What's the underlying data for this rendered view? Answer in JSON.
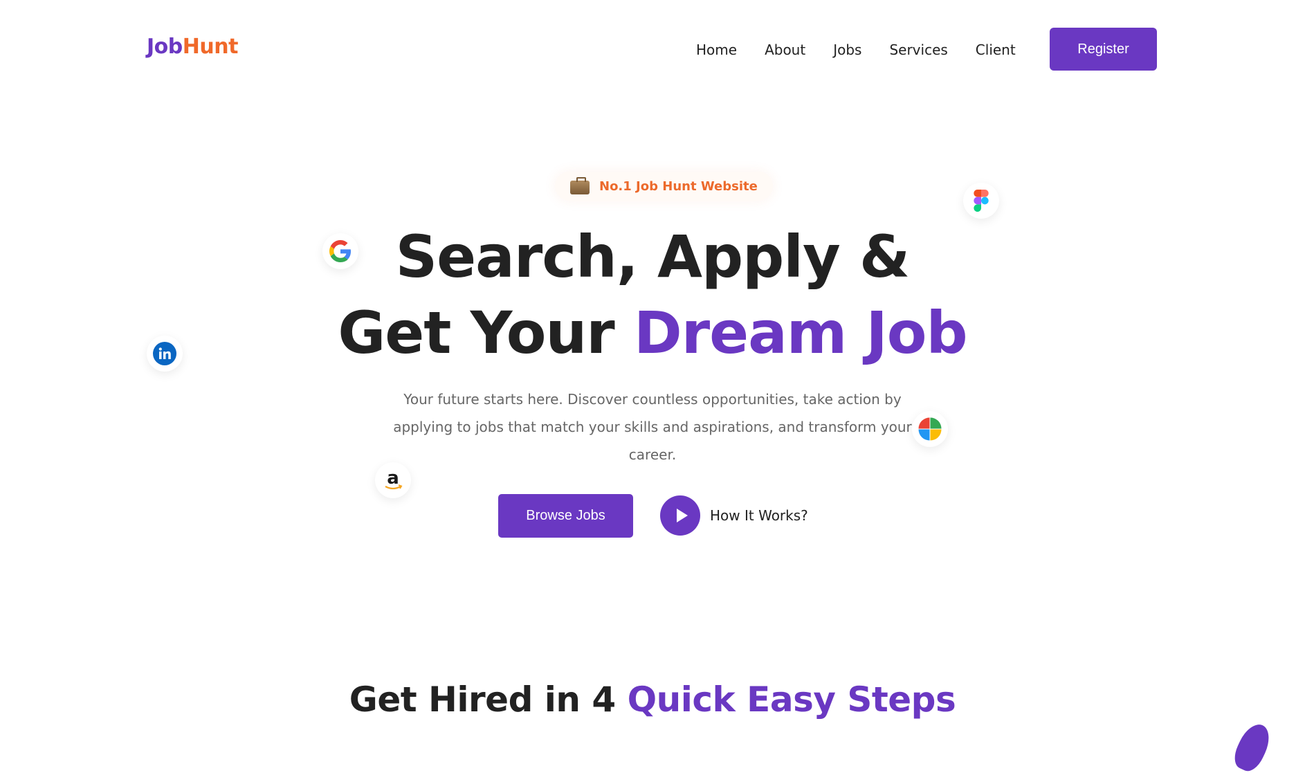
{
  "header": {
    "logo": {
      "part1": "Job",
      "part2": "Hunt"
    },
    "nav": [
      "Home",
      "About",
      "Jobs",
      "Services",
      "Client"
    ],
    "register_label": "Register"
  },
  "hero": {
    "badge": {
      "icon": "briefcase-icon",
      "text": "No.1 Job Hunt Website"
    },
    "title_line1": "Search, Apply &",
    "title_line2_plain": "Get Your ",
    "title_line2_accent": "Dream Job",
    "description": "Your future starts here. Discover countless opportunities, take action by applying to jobs that match your skills and aspirations, and transform your career.",
    "browse_label": "Browse Jobs",
    "how_label": "How It Works?",
    "floating_logos": [
      "google-logo",
      "figma-logo",
      "linkedin-logo",
      "microsoft-logo",
      "amazon-logo"
    ]
  },
  "steps_section": {
    "title_plain": "Get Hired in 4 ",
    "title_accent": "Quick Easy Steps"
  },
  "colors": {
    "brand": "#6a38c2",
    "accent": "#f0692a"
  }
}
